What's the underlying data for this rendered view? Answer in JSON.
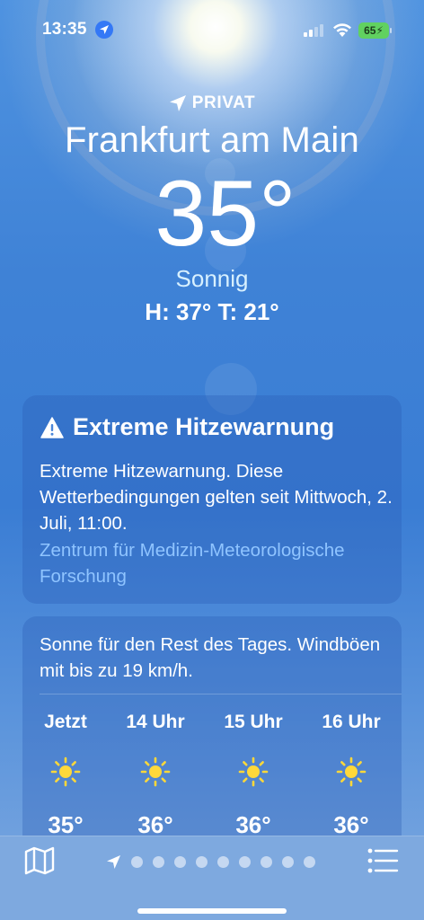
{
  "status_bar": {
    "time": "13:35",
    "battery": "65"
  },
  "header": {
    "location_tag": "PRIVAT",
    "city": "Frankfurt am Main",
    "temperature": "35°",
    "condition": "Sonnig",
    "hilo": "H: 37°  T: 21°"
  },
  "warning": {
    "title": "Extreme Hitzewarnung",
    "body": "Extreme Hitzewarnung. Diese Wetterbedingungen gelten seit Mittwoch, 2. Juli, 11:00.",
    "source": "Zentrum für Medizin-Meteorologische Forschung"
  },
  "forecast": {
    "summary": "Sonne für den Rest des Tages. Windböen mit bis zu 19 km/h.",
    "hours": [
      {
        "label": "Jetzt",
        "icon": "sun-icon",
        "temp": "35°"
      },
      {
        "label": "14 Uhr",
        "icon": "sun-icon",
        "temp": "36°"
      },
      {
        "label": "15 Uhr",
        "icon": "sun-icon",
        "temp": "36°"
      },
      {
        "label": "16 Uhr",
        "icon": "sun-icon",
        "temp": "36°"
      }
    ]
  },
  "toolbar": {
    "page_count": 9,
    "current_page": 0
  },
  "colors": {
    "accent_link": "#8fc4ff",
    "condition": "#d7f0ff",
    "sun": "#ffd83a",
    "battery": "#61d160"
  }
}
